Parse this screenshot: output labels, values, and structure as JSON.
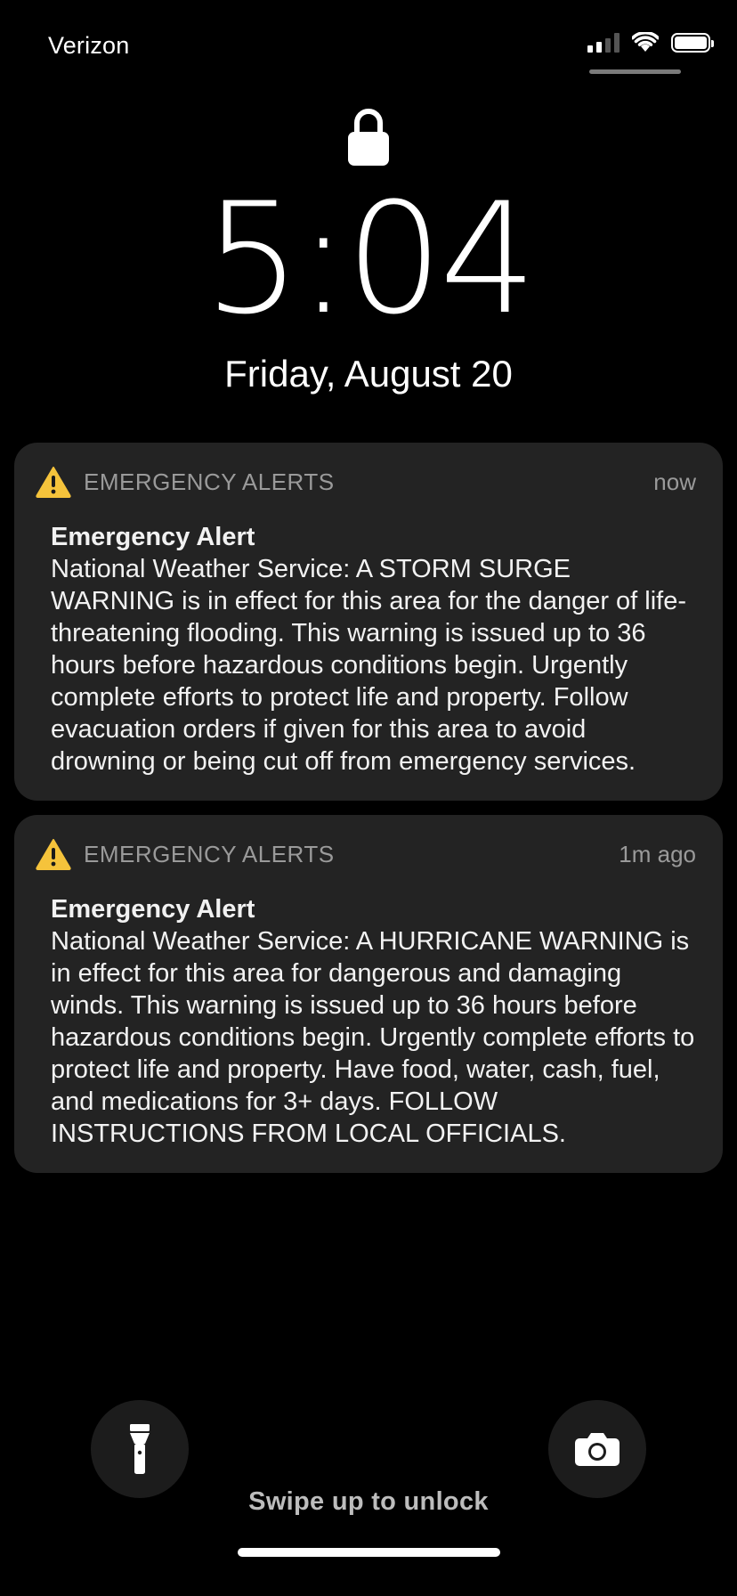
{
  "status_bar": {
    "carrier": "Verizon",
    "cell_signal_bars": 2,
    "battery_level": 1.0
  },
  "lock_screen": {
    "time": "5:04",
    "date": "Friday, August 20"
  },
  "notifications": [
    {
      "app_name": "EMERGENCY ALERTS",
      "time": "now",
      "title": "Emergency Alert",
      "body": "National Weather Service: A STORM SURGE WARNING is in effect for this area for the danger of life-threatening flooding. This warning is issued up to 36 hours before hazardous conditions begin. Urgently complete efforts to protect life and property. Follow evacuation orders if given for this area to avoid drowning or being cut off from emergency services."
    },
    {
      "app_name": "EMERGENCY ALERTS",
      "time": "1m ago",
      "title": "Emergency Alert",
      "body": "National Weather Service: A HURRICANE WARNING is in effect for this area for dangerous and damaging winds. This warning is issued up to 36 hours before hazardous conditions begin. Urgently complete efforts to protect life and property. Have food, water, cash, fuel, and medications for 3+ days. FOLLOW INSTRUCTIONS FROM LOCAL OFFICIALS."
    }
  ],
  "bottom": {
    "swipe_hint": "Swipe up to unlock"
  },
  "icons": {
    "lock": "lock-icon",
    "warning": "warning-icon",
    "flashlight": "flashlight-icon",
    "camera": "camera-icon"
  },
  "colors": {
    "background": "#000000",
    "notification_bg": "#232323",
    "warning_yellow": "#F5C33B"
  }
}
